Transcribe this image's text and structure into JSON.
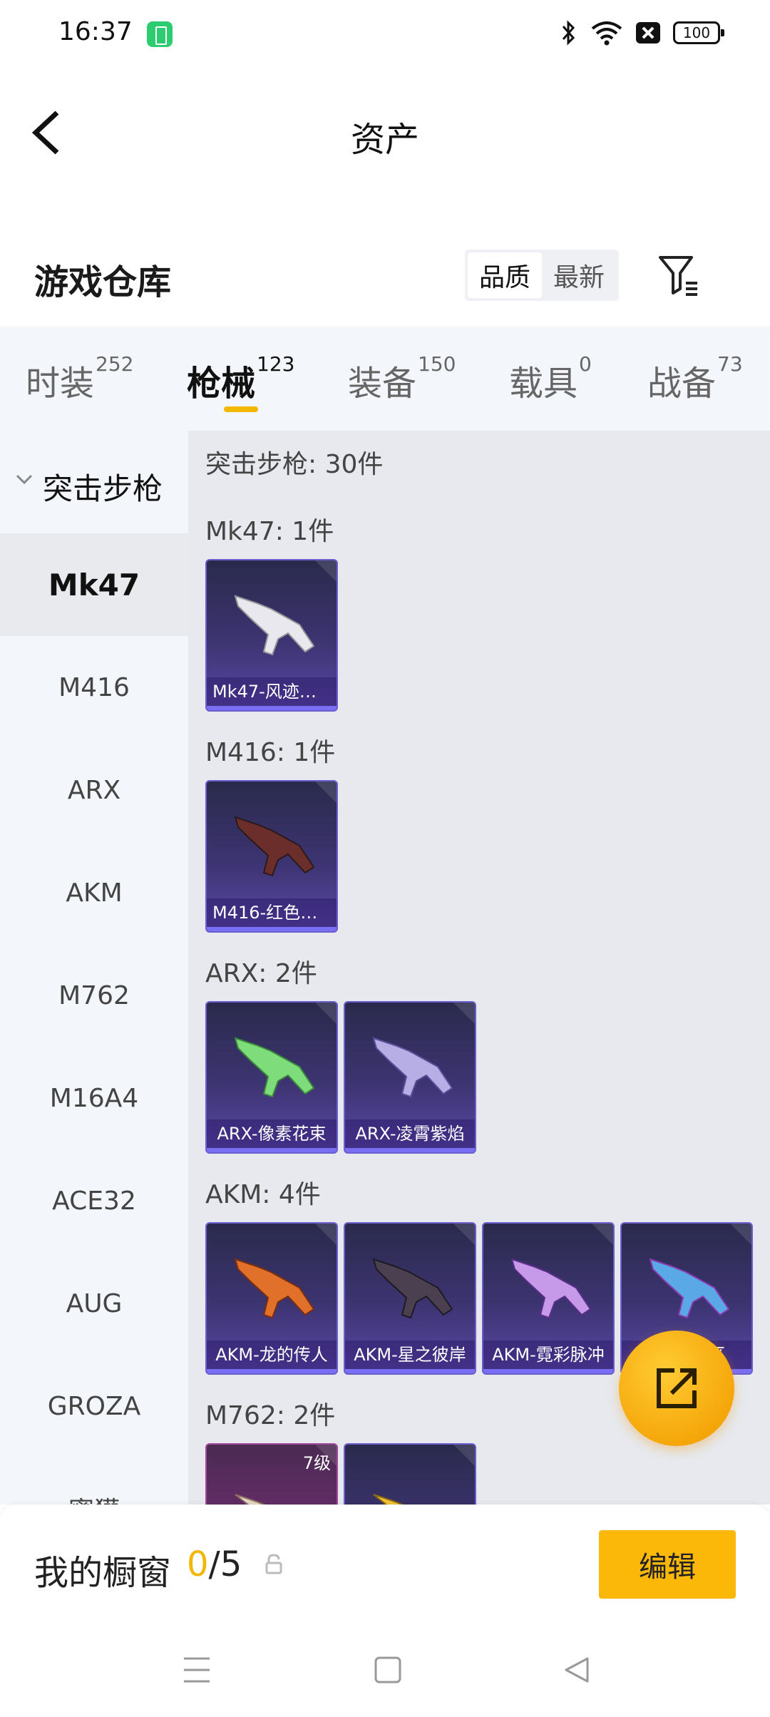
{
  "status": {
    "time": "16:37",
    "battery": "100"
  },
  "header": {
    "title": "资产"
  },
  "warehouse": {
    "title": "游戏仓库",
    "sort_options": [
      "品质",
      "最新"
    ],
    "active_sort": "品质"
  },
  "tabs": [
    {
      "label": "时装",
      "count": "252"
    },
    {
      "label": "枪械",
      "count": "123"
    },
    {
      "label": "装备",
      "count": "150"
    },
    {
      "label": "载具",
      "count": "0"
    },
    {
      "label": "战备",
      "count": "73"
    }
  ],
  "active_tab": "枪械",
  "sidebar": {
    "group_label": "突击步枪",
    "items": [
      "Mk47",
      "M416",
      "ARX",
      "AKM",
      "M762",
      "M16A4",
      "ACE32",
      "AUG",
      "GROZA",
      "蜜獾"
    ],
    "active_item": "Mk47"
  },
  "content": {
    "summary": "突击步枪: 30件",
    "groups": [
      {
        "title": "Mk47: 1件",
        "items": [
          {
            "label": "Mk47-风迹短..."
          }
        ]
      },
      {
        "title": "M416: 1件",
        "items": [
          {
            "label": "M416-红色方..."
          }
        ]
      },
      {
        "title": "ARX: 2件",
        "items": [
          {
            "label": "ARX-像素花束"
          },
          {
            "label": "ARX-凌霄紫焰"
          }
        ]
      },
      {
        "title": "AKM: 4件",
        "items": [
          {
            "label": "AKM-龙的传人"
          },
          {
            "label": "AKM-星之彼岸"
          },
          {
            "label": "AKM-霓彩脉冲"
          },
          {
            "label": "AKM-...区"
          }
        ]
      },
      {
        "title": "M762: 2件",
        "items": [
          {
            "label": "",
            "level": "7级"
          },
          {
            "label": ""
          }
        ]
      }
    ]
  },
  "bottom": {
    "showcase_label": "我的橱窗",
    "showcase_current": "0",
    "showcase_total": "/5",
    "edit_label": "编辑"
  },
  "colors": {
    "accent": "#f2b705",
    "card_bg": "#3d3472"
  }
}
